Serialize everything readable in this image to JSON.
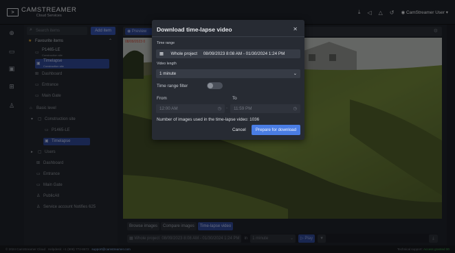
{
  "app": {
    "logo_name": "CAMSTREAMER",
    "logo_sub": "Cloud Services",
    "user": "CamStreamer User"
  },
  "sidebar": {
    "search_placeholder": "Search items",
    "add_label": "Add item",
    "favourites_title": "Favourite items",
    "fav": [
      {
        "label": "P1465-LE",
        "sub": "Construction site"
      },
      {
        "label": "Timelapse",
        "sub": "Construction site"
      },
      {
        "label": "Dashboard"
      },
      {
        "label": "Entrance"
      },
      {
        "label": "Main Gate"
      }
    ],
    "tree": [
      {
        "label": "Basic level"
      },
      {
        "label": "Construction site"
      },
      {
        "label": "P1465-LE"
      },
      {
        "label": "Timelapse"
      },
      {
        "label": "Users"
      },
      {
        "label": "Dashboard"
      },
      {
        "label": "Entrance"
      },
      {
        "label": "Main Gate"
      },
      {
        "label": "PublicAll"
      },
      {
        "label": "Service account Notifies 625"
      }
    ]
  },
  "main": {
    "preview_label": "Preview",
    "cam_timestamp": "08/09/2023 0",
    "tabs": [
      "Browse images",
      "Compare images",
      "Time-lapse video"
    ],
    "ctrl": {
      "range_label": "Whole project",
      "range_value": "08/09/2023 8:08 AM - 01/30/2024 1:24 PM",
      "in_label": "in",
      "length": "1 minute",
      "play": "Play"
    }
  },
  "footer": {
    "left": "© 2024 CamStreamer Cloud",
    "helpdesk": "Helpdesk: +1 (908) 772-8672",
    "email": "support@camstreamer.com",
    "right_label": "Technical support:",
    "right_status": "Access granted 00"
  },
  "dialog": {
    "title": "Download time-lapse video",
    "time_range_label": "Time range",
    "time_range_name": "Whole project",
    "time_range_value": "08/09/2023 8:08 AM - 01/30/2024 1:24 PM",
    "video_length_label": "Video length",
    "video_length": "1 minute",
    "filter_label": "Time range filter",
    "from_label": "From",
    "to_label": "To",
    "from_value": "12:00 AM",
    "to_value": "11:59 PM",
    "images_text": "Number of images used in the time-lapse video: 1036",
    "cancel": "Cancel",
    "prepare": "Prepare for download"
  },
  "colors": {
    "accent": "#4a7de4",
    "selected": "#2e4690",
    "panel": "#272b33"
  }
}
